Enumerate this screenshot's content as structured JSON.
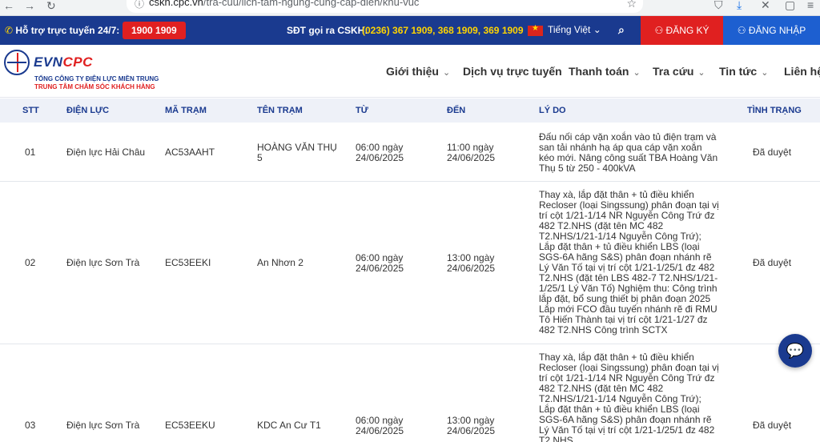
{
  "browser": {
    "url_host": "cskh.cpc.vn",
    "url_path": "/tra-cuu/lich-tam-ngung-cung-cap-dien/khu-vuc"
  },
  "topbar": {
    "hotline_label": "Hỗ trợ trực tuyến 24/7:",
    "hotline_number": "1900 1909",
    "cskh_label": "SĐT gọi ra CSKH:",
    "cskh_numbers": "(0236) 367 1909, 368 1909, 369 1909",
    "language": "Tiếng Việt ⌄",
    "register": "ĐĂNG KÝ",
    "login": "ĐĂNG NHẬP"
  },
  "logo": {
    "evn": "EVN",
    "cpc": "CPC",
    "line1": "TỔNG CÔNG TY ĐIỆN LỰC MIỀN TRUNG",
    "line2": "TRUNG TÂM CHĂM SÓC KHÁCH HÀNG"
  },
  "menu": {
    "items": [
      {
        "label": "Giới thiệu",
        "chevron": true
      },
      {
        "label": "Dịch vụ trực tuyến",
        "chevron": false
      },
      {
        "label": "Thanh toán",
        "chevron": true
      },
      {
        "label": "Tra cứu",
        "chevron": true
      },
      {
        "label": "Tin tức",
        "chevron": true
      },
      {
        "label": "Liên hệ",
        "chevron": false
      }
    ]
  },
  "table": {
    "headers": {
      "stt": "STT",
      "unit": "ĐIỆN LỰC",
      "station_code": "MÃ TRẠM",
      "station_name": "TÊN TRẠM",
      "from": "TỪ",
      "to": "ĐẾN",
      "reason": "LÝ DO",
      "status": "TÌNH TRẠNG"
    },
    "rows": [
      {
        "stt": "01",
        "unit": "Điện lực Hải Châu",
        "station_code": "AC53AAHT",
        "station_name": "HOÀNG VĂN THỤ 5",
        "from": "06:00 ngày 24/06/2025",
        "to": "11:00 ngày 24/06/2025",
        "reason": "Đấu nối cáp vặn xoắn vào tủ điện trạm và san tải nhánh hạ áp qua cáp vặn xoắn kéo mới. Nâng công suất TBA Hoàng Văn Thụ 5 từ 250 - 400kVA",
        "status": "Đã duyệt"
      },
      {
        "stt": "02",
        "unit": "Điện lực Sơn Trà",
        "station_code": "EC53EEKI",
        "station_name": "An Nhơn 2",
        "from": "06:00 ngày 24/06/2025",
        "to": "13:00 ngày 24/06/2025",
        "reason": "Thay xà, lắp đặt thân + tủ điều khiển Recloser (loại Singssung) phân đoạn tại vị trí cột 1/21-1/14 NR Nguyễn Công Trứ đz 482 T2.NHS (đặt tên MC 482 T2.NHS/1/21-1/14 Nguyễn Công Trứ); Lắp đặt thân + tủ điều khiển LBS (loại SGS-6A hãng S&S) phân đoạn nhánh rẽ Lý Văn Tố tại vị trí cột 1/21-1/25/1 đz 482 T2.NHS (đặt tên LBS 482-7 T2.NHS/1/21-1/25/1 Lý Văn Tố) Nghiệm thu: Công trình lắp đặt, bổ sung thiết bị phân đoạn 2025 Lắp mới FCO đầu tuyến nhánh rẽ đi RMU Tô Hiến Thành tại vị trí cột 1/21-1/27 đz 482 T2.NHS Công trình SCTX",
        "status": "Đã duyệt"
      },
      {
        "stt": "03",
        "unit": "Điện lực Sơn Trà",
        "station_code": "EC53EEKU",
        "station_name": "KDC An Cư T1",
        "from": "06:00 ngày 24/06/2025",
        "to": "13:00 ngày 24/06/2025",
        "reason": "Thay xà, lắp đặt thân + tủ điều khiển Recloser (loại Singssung) phân đoạn tại vị trí cột 1/21-1/14 NR Nguyễn Công Trứ đz 482 T2.NHS (đặt tên MC 482 T2.NHS/1/21-1/14 Nguyễn Công Trứ); Lắp đặt thân + tủ điều khiển LBS (loại SGS-6A hãng S&S) phân đoạn nhánh rẽ Lý Văn Tố tại vị trí cột 1/21-1/25/1 đz 482 T2.NHS",
        "status": "Đã duyệt"
      }
    ]
  }
}
